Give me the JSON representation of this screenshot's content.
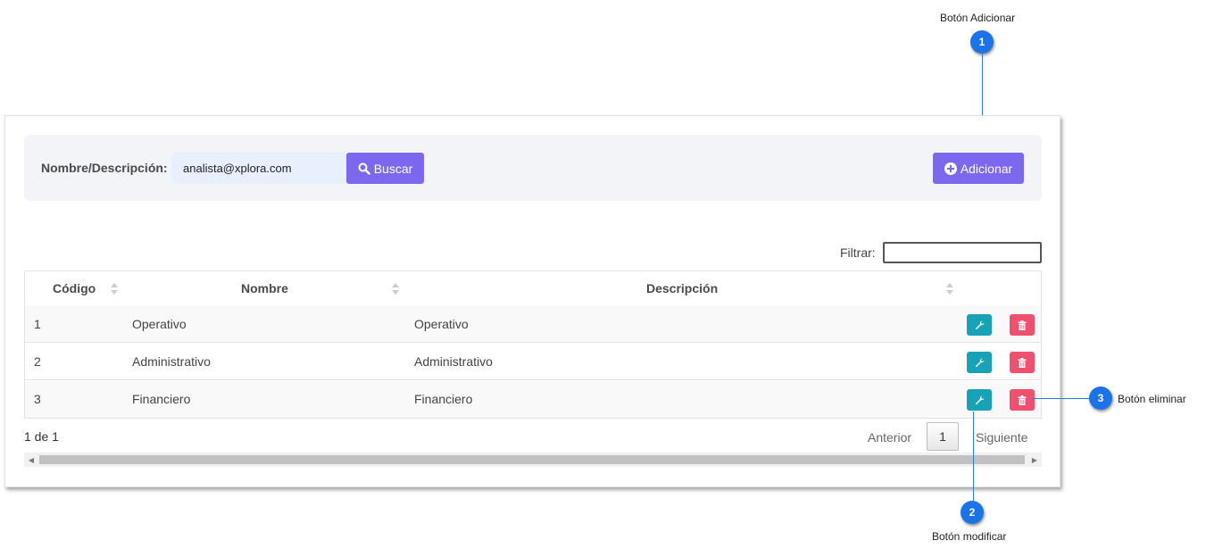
{
  "search": {
    "label": "Nombre/Descripción:",
    "value": "analista@xplora.com",
    "search_button": "Buscar",
    "add_button": "Adicionar"
  },
  "filter": {
    "label": "Filtrar:",
    "value": ""
  },
  "table": {
    "headers": {
      "codigo": "Código",
      "nombre": "Nombre",
      "descripcion": "Descripción"
    },
    "rows": [
      {
        "codigo": "1",
        "nombre": "Operativo",
        "descripcion": "Operativo"
      },
      {
        "codigo": "2",
        "nombre": "Administrativo",
        "descripcion": "Administrativo"
      },
      {
        "codigo": "3",
        "nombre": "Financiero",
        "descripcion": "Financiero"
      }
    ]
  },
  "pagination": {
    "info": "1 de 1",
    "prev": "Anterior",
    "current": "1",
    "next": "Siguiente"
  },
  "callouts": [
    {
      "number": "1",
      "label": "Botón  Adicionar"
    },
    {
      "number": "2",
      "label": "Botón modificar"
    },
    {
      "number": "3",
      "label": "Botón eliminar"
    }
  ],
  "colors": {
    "primary": "#7b68ee",
    "edit": "#17a2b8",
    "delete": "#f0506e",
    "callout": "#1a73e8"
  },
  "icons": {
    "search": "search-icon",
    "add": "plus-circle-icon",
    "edit": "wrench-icon",
    "delete": "trash-icon"
  }
}
